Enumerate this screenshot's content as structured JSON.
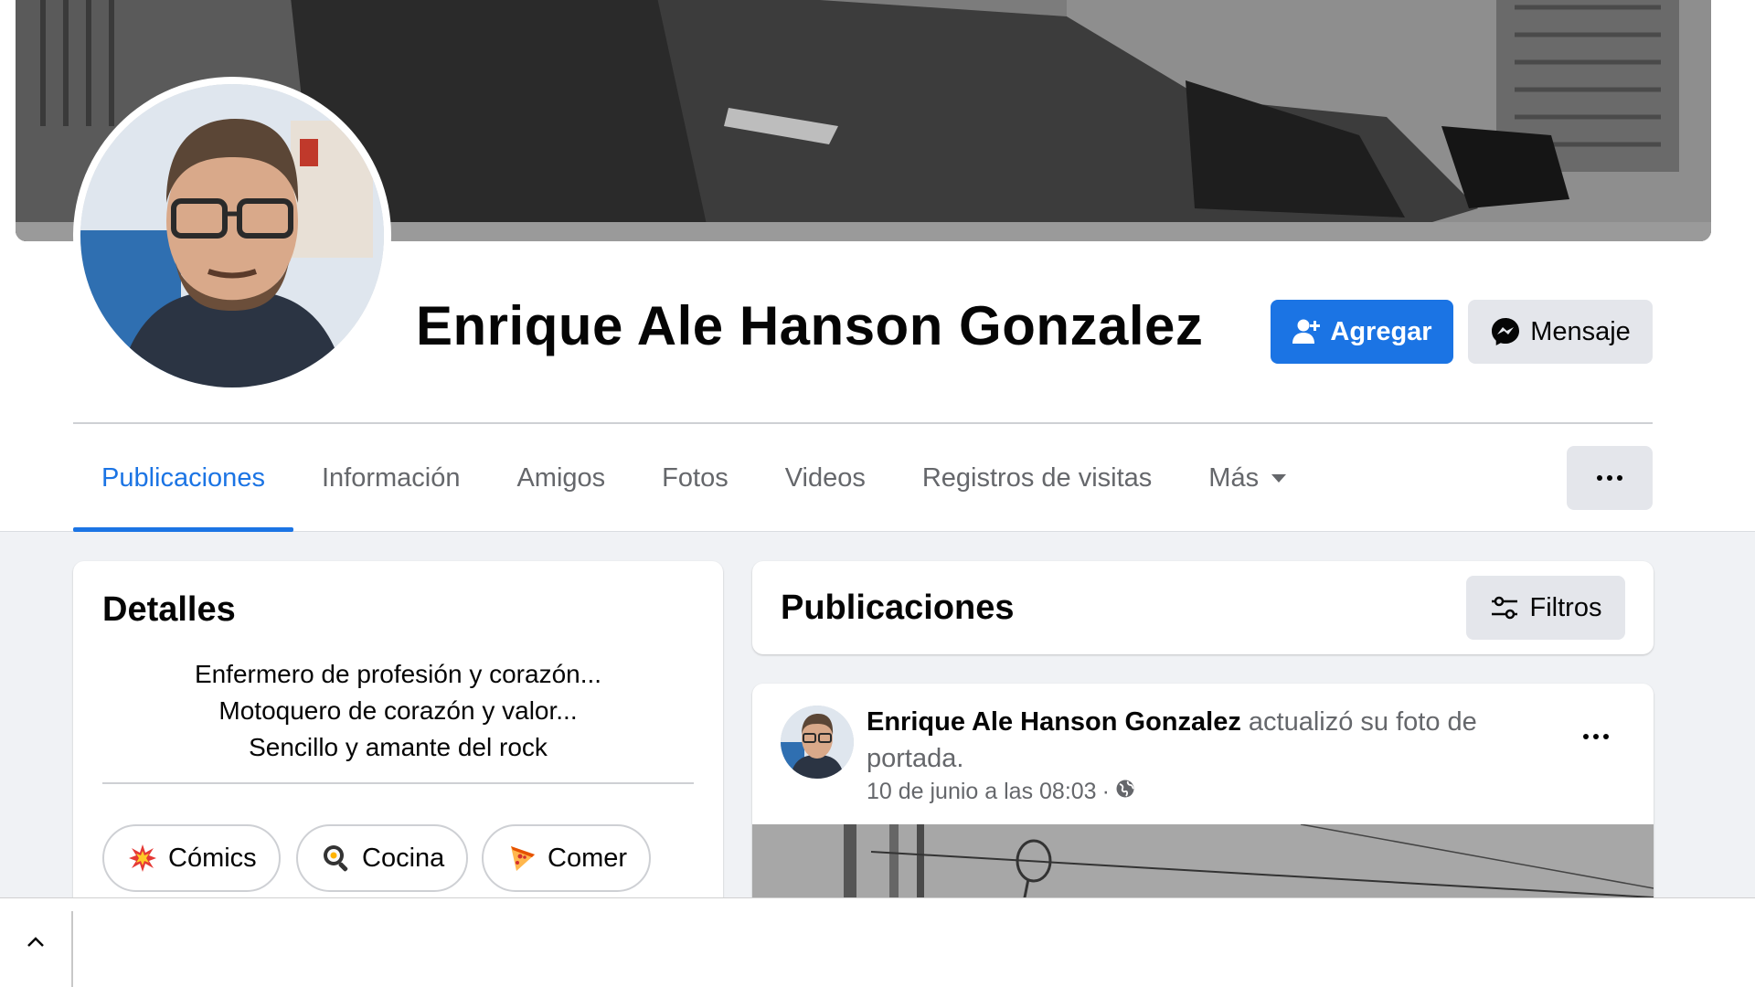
{
  "profile": {
    "name": "Enrique Ale Hanson Gonzalez",
    "add_friend_label": "Agregar",
    "message_label": "Mensaje"
  },
  "tabs": [
    {
      "label": "Publicaciones",
      "active": true
    },
    {
      "label": "Información"
    },
    {
      "label": "Amigos"
    },
    {
      "label": "Fotos"
    },
    {
      "label": "Videos"
    },
    {
      "label": "Registros de visitas"
    },
    {
      "label": "Más"
    }
  ],
  "details": {
    "title": "Detalles",
    "bio": [
      "Enfermero de profesión y corazón...",
      "Motoquero de corazón y valor...",
      "Sencillo y amante del rock"
    ],
    "hobbies": [
      {
        "label": "Cómics",
        "icon": "explosion-emoji-icon"
      },
      {
        "label": "Cocina",
        "icon": "frying-pan-emoji-icon"
      },
      {
        "label": "Comer",
        "icon": "pizza-emoji-icon"
      }
    ]
  },
  "posts": {
    "title": "Publicaciones",
    "filters_label": "Filtros"
  },
  "post": {
    "author": "Enrique Ale Hanson Gonzalez",
    "action": "actualizó su foto de portada.",
    "timestamp": "10 de junio a las 08:03",
    "separator": "·",
    "audience_icon": "globe-icon"
  },
  "colors": {
    "accent": "#1b74e4",
    "secondary_button": "#e4e6eb",
    "muted_text": "#65676b",
    "page_background": "#f0f2f5"
  }
}
